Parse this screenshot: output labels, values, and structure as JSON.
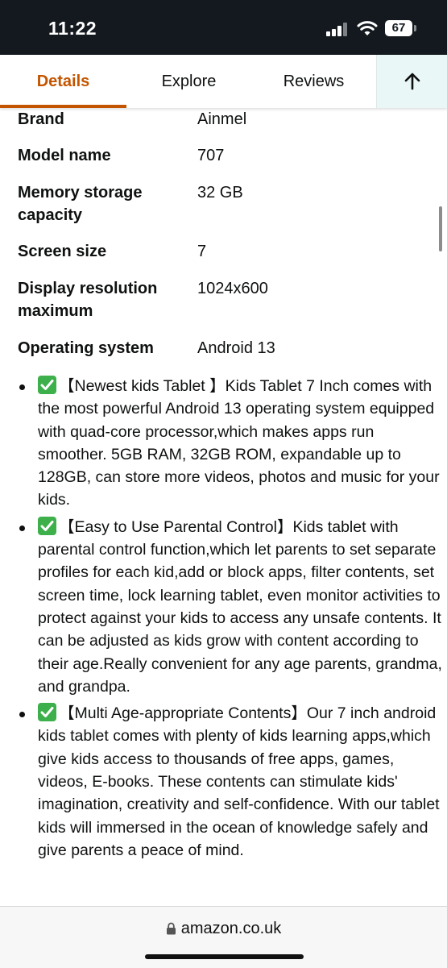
{
  "status_bar": {
    "time": "11:22",
    "battery": "67"
  },
  "tabs": [
    {
      "label": "Details",
      "active": true
    },
    {
      "label": "Explore",
      "active": false
    },
    {
      "label": "Reviews",
      "active": false
    }
  ],
  "specs": [
    {
      "key": "Brand",
      "value": "Ainmel"
    },
    {
      "key": "Model name",
      "value": "707"
    },
    {
      "key": "Memory storage capacity",
      "value": "32 GB"
    },
    {
      "key": "Screen size",
      "value": "7"
    },
    {
      "key": "Display resolution maximum",
      "value": "1024x600"
    },
    {
      "key": "Operating system",
      "value": "Android 13"
    }
  ],
  "bullets": [
    "【Newest kids Tablet 】Kids Tablet 7 Inch comes with the most powerful Android 13 operating system equipped with quad-core processor,which makes apps run smoother. 5GB RAM, 32GB ROM, expandable up to 128GB, can store more videos, photos and music for your kids.",
    "【Easy to Use Parental Control】Kids tablet with parental control function,which let parents to set separate profiles for each kid,add or block apps, filter contents, set screen time, lock learning tablet, even monitor activities to protect against your kids to access any unsafe contents. It can be adjusted as kids grow with content according to their age.Really convenient for any age parents, grandma, and grandpa.",
    "【Multi Age-appropriate Contents】Our 7 inch android kids tablet comes with plenty of kids learning apps,which give kids access to thousands of free apps, games, videos, E-books. These contents can stimulate kids' imagination, creativity and self-confidence. With our tablet kids will immersed in the ocean of knowledge safely and give parents a peace of mind."
  ],
  "browser": {
    "url": "amazon.co.uk"
  },
  "colors": {
    "accent": "#c45500",
    "check_green": "#3db04b",
    "status_bg": "#13191f"
  }
}
